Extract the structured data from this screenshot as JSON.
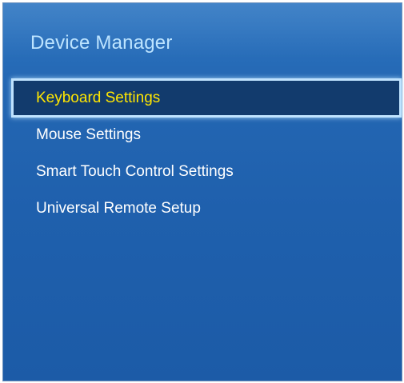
{
  "panel": {
    "title": "Device Manager"
  },
  "menu": {
    "selected_index": 0,
    "items": [
      {
        "label": "Keyboard Settings"
      },
      {
        "label": "Mouse Settings"
      },
      {
        "label": "Smart Touch Control Settings"
      },
      {
        "label": "Universal Remote Setup"
      }
    ]
  },
  "colors": {
    "panel_background": "#1f60ad",
    "title_text": "#bde4ff",
    "item_text": "#ffffff",
    "selected_text": "#ffe600",
    "selected_background": "#123b6d",
    "selected_outline": "#bfe3ff"
  }
}
